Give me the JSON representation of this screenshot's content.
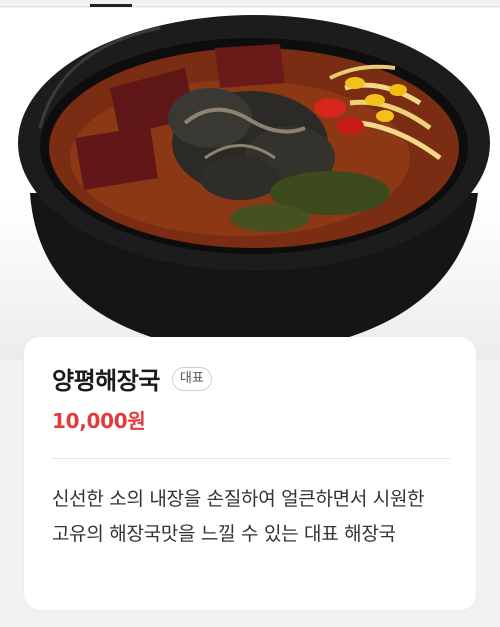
{
  "menu": {
    "name": "양평해장국",
    "badge": "대표",
    "price": "10,000원",
    "description": "신선한 소의 내장을 손질하여 얼큰하면서 시원한 고유의 해장국맛을 느낄 수 있는 대표 해장국"
  },
  "image": {
    "subject": "yangpyeong-haejangguk-bowl"
  },
  "colors": {
    "price": "#e23b3b",
    "background": "#f2f2f2",
    "card": "#ffffff",
    "tab_indicator": "#222222"
  }
}
